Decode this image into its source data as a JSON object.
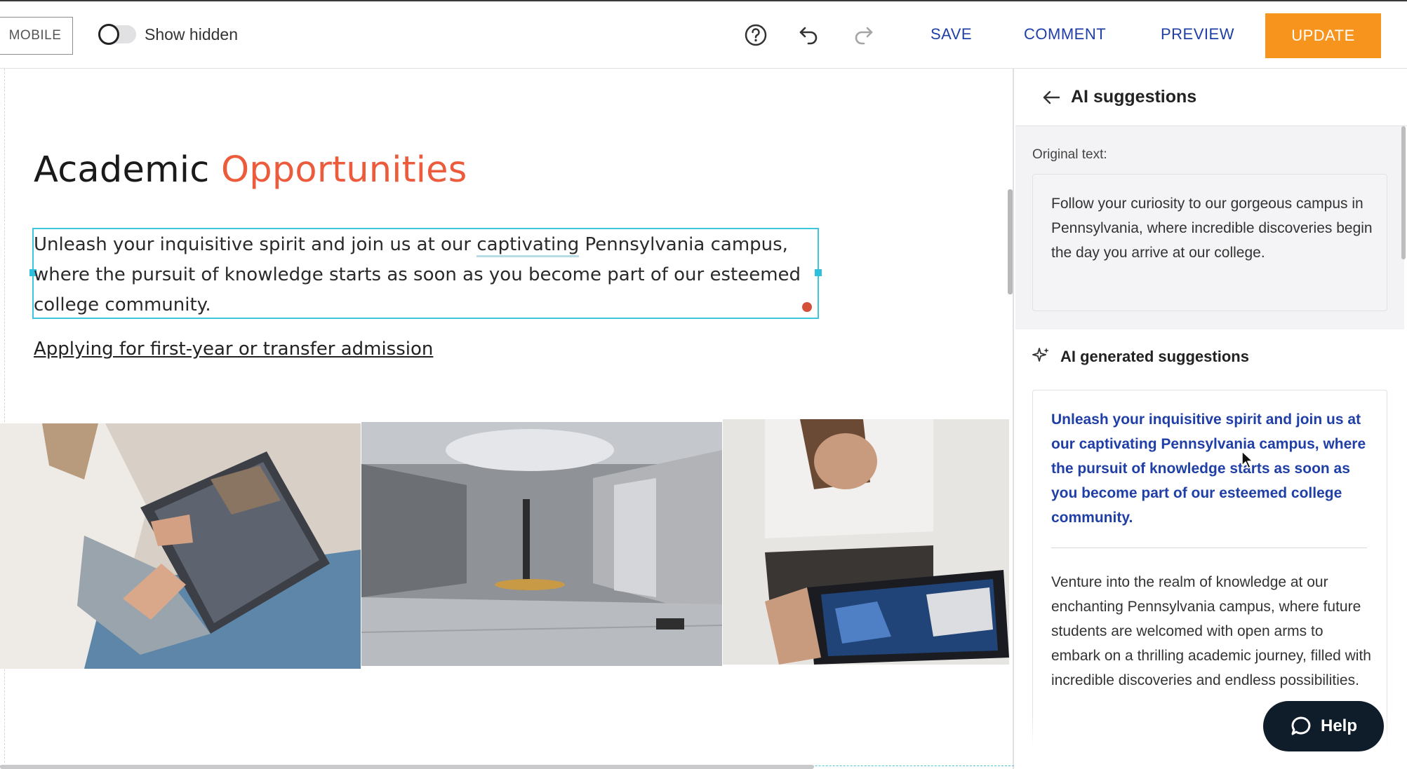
{
  "toolbar": {
    "mobile_label": "MOBILE",
    "show_hidden_label": "Show hidden",
    "save_label": "SAVE",
    "comment_label": "COMMENT",
    "preview_label": "PREVIEW",
    "update_label": "UPDATE",
    "help_icon": "question-circle-icon",
    "undo_icon": "undo-icon",
    "redo_icon": "redo-icon"
  },
  "canvas": {
    "heading_plain": "Academic ",
    "heading_accent": "Opportunities",
    "para_before": "Unleash your inquisitive spirit and join us at our ",
    "para_underlined": "captivating",
    "para_after": " Pennsylvania campus, where the pursuit of knowledge starts as soon as you become part of our esteemed college community.",
    "admission_link": "Applying for first-year or transfer admission"
  },
  "panel": {
    "title": "AI suggestions",
    "original_label": "Original text:",
    "original_text": "Follow your curiosity to our gorgeous campus in Pennsylvania, where incredible discoveries begin the day you arrive at our college.",
    "ai_label": "AI generated suggestions",
    "suggestion_1": "Unleash your inquisitive spirit and join us at our captivating Pennsylvania campus, where the pursuit of knowledge starts as soon as you become part of our esteemed college community.",
    "suggestion_2": "Venture into the realm of knowledge at our enchanting Pennsylvania campus, where future students are welcomed with open arms to embark on a thrilling academic journey, filled with incredible discoveries and endless possibilities."
  },
  "help": {
    "label": "Help"
  },
  "colors": {
    "accent_orange": "#f7941d",
    "heading_accent": "#ec5b3b",
    "link_blue": "#1f3fa6",
    "selection_cyan": "#3ec6dd"
  }
}
